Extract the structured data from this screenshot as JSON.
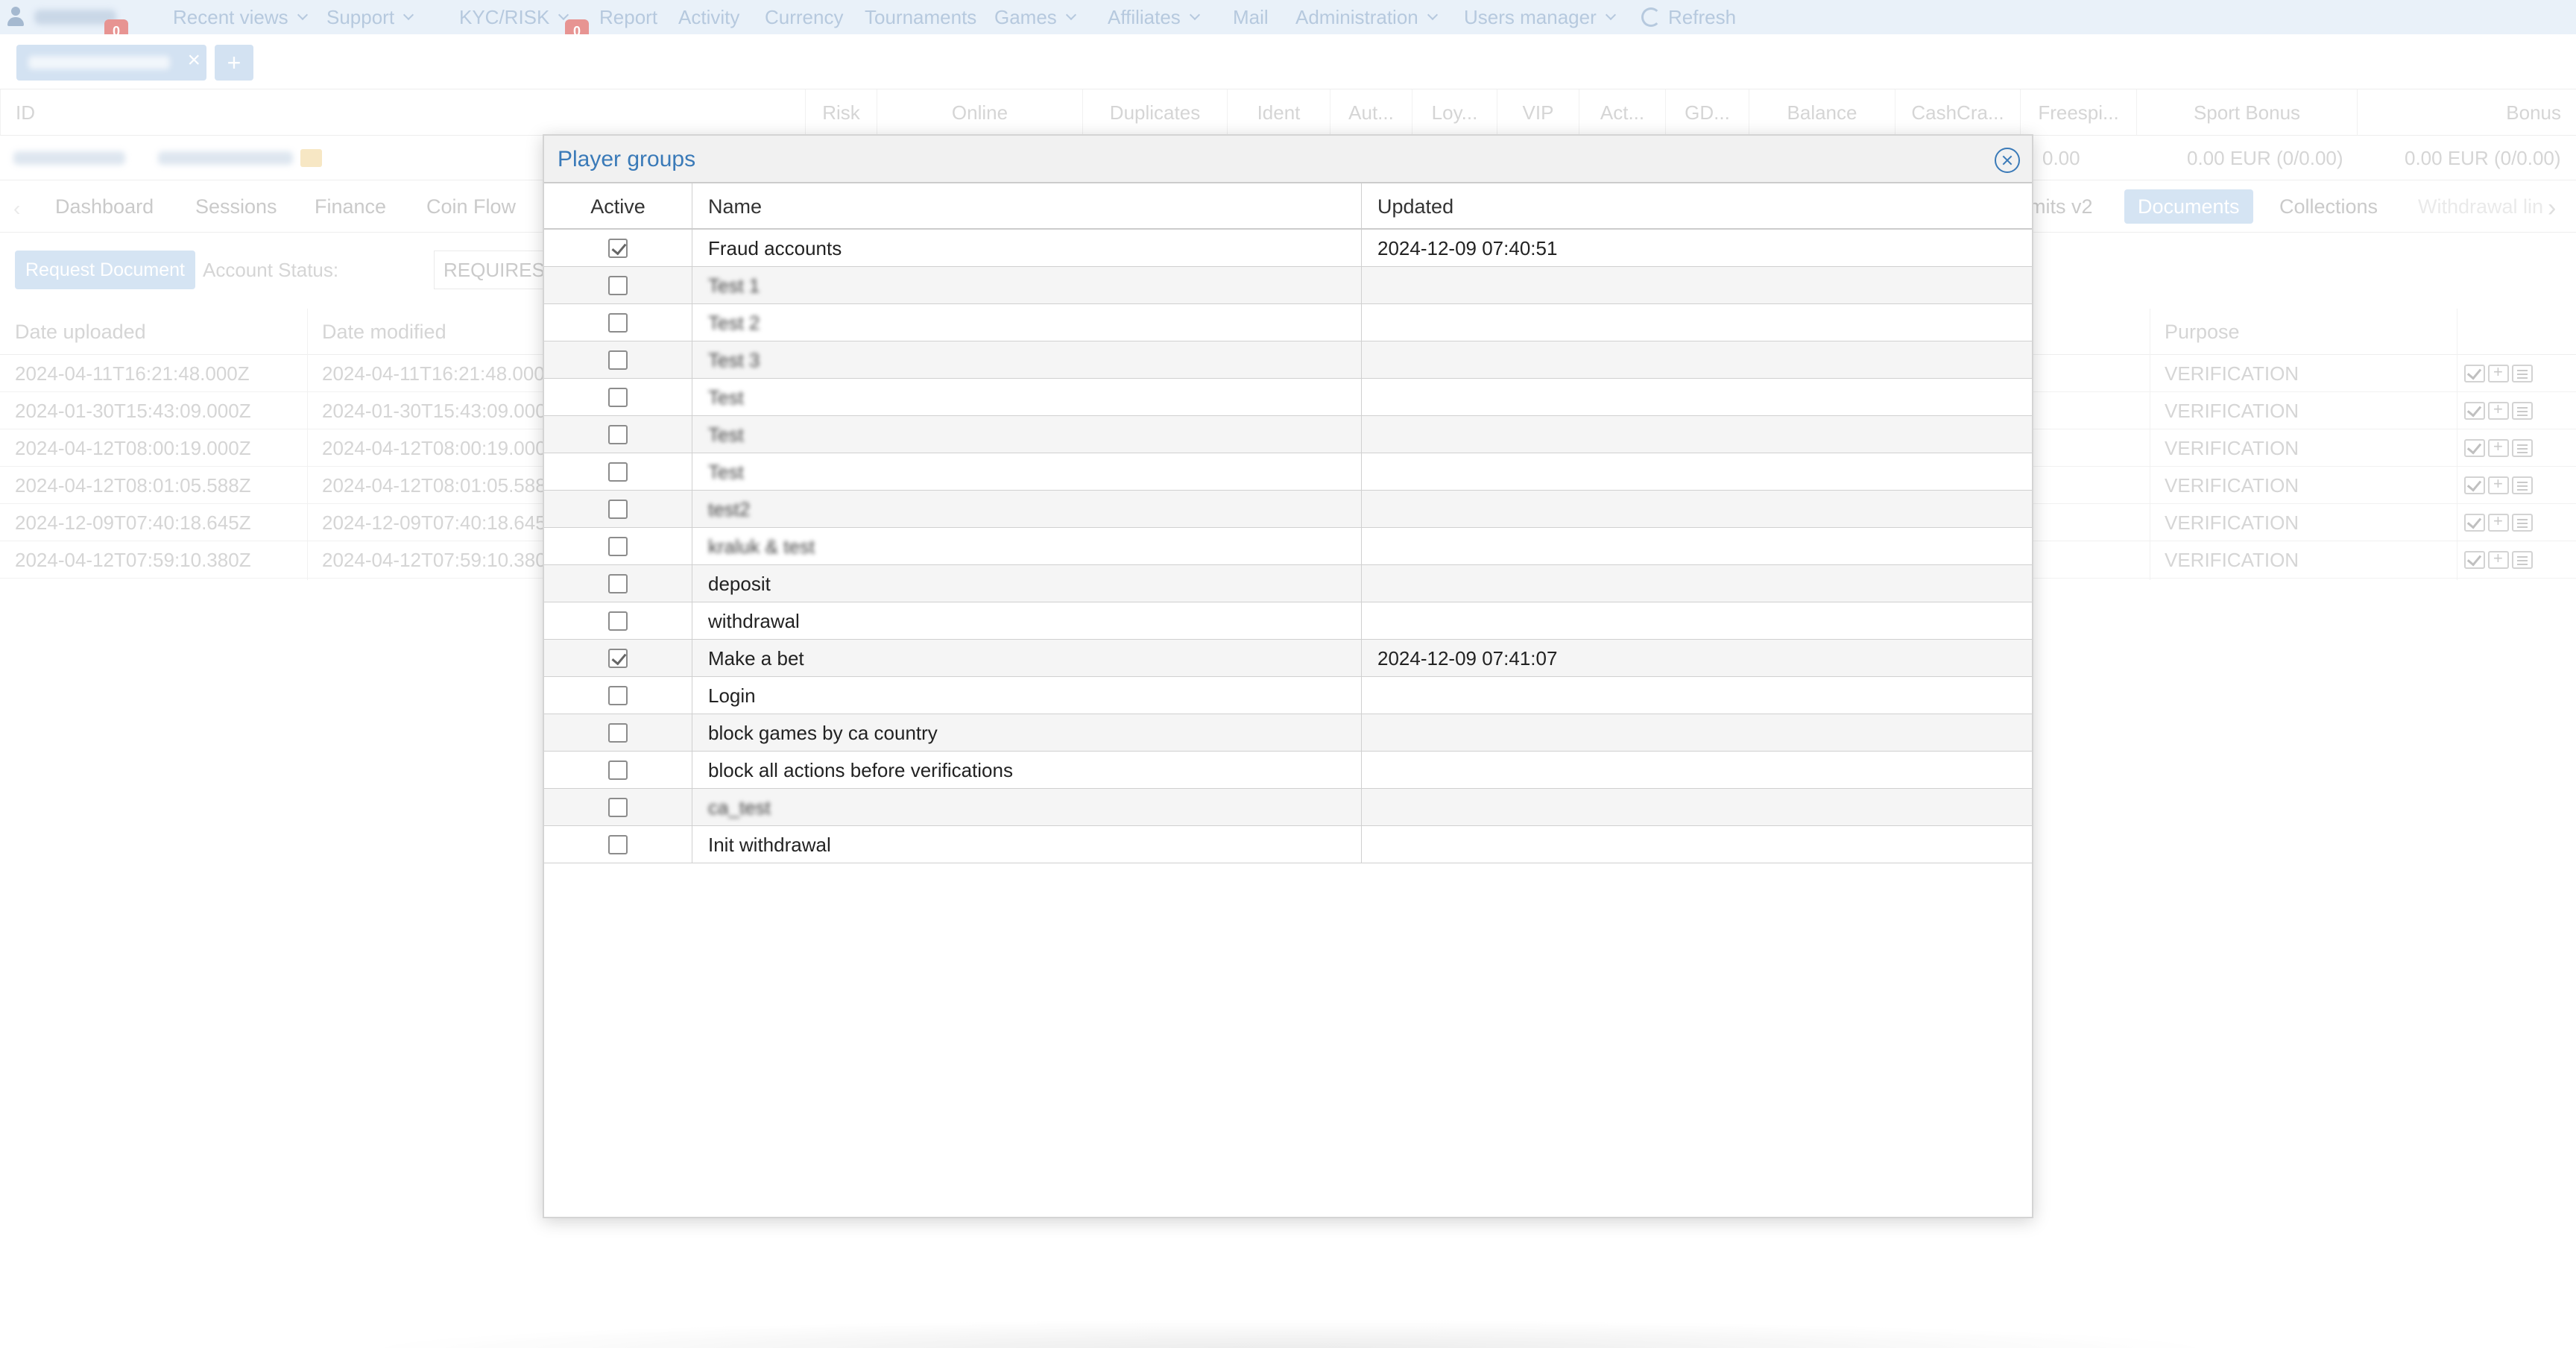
{
  "nav": {
    "user_badge": "0",
    "kyc_badge": "0",
    "items": [
      {
        "label": "Recent views",
        "chevron": true
      },
      {
        "label": "Support",
        "chevron": true
      },
      {
        "label": "KYC/RISK",
        "chevron": true
      },
      {
        "label": "Report",
        "chevron": false
      },
      {
        "label": "Activity",
        "chevron": false
      },
      {
        "label": "Currency",
        "chevron": false
      },
      {
        "label": "Tournaments",
        "chevron": false
      },
      {
        "label": "Games",
        "chevron": true
      },
      {
        "label": "Affiliates",
        "chevron": true
      },
      {
        "label": "Mail",
        "chevron": false
      },
      {
        "label": "Administration",
        "chevron": true
      },
      {
        "label": "Users manager",
        "chevron": true
      }
    ],
    "refresh_label": "Refresh"
  },
  "tabs": {
    "close_symbol": "×",
    "add_symbol": "+"
  },
  "player_header": {
    "columns": [
      "ID",
      "Risk",
      "Online",
      "Duplicates",
      "Ident",
      "Aut...",
      "Loy...",
      "VIP",
      "Act...",
      "GD...",
      "Balance",
      "CashCra...",
      "Freespi...",
      "Sport Bonus",
      "Bonus"
    ],
    "freespins_value": "0.00",
    "sport_bonus_value": "0.00 EUR (0/0.00)",
    "bonus_value": "0.00 EUR (0/0.00)"
  },
  "sections": {
    "tabs": [
      "Dashboard",
      "Sessions",
      "Finance",
      "Coin Flow",
      "mits v2",
      "Documents",
      "Collections",
      "Withdrawal lin"
    ],
    "active": "Documents"
  },
  "toolbar": {
    "request_label": "Request Document",
    "account_status_label": "Account Status:",
    "account_status_value": "REQUIRES"
  },
  "documents": {
    "headers": {
      "uploaded": "Date uploaded",
      "modified": "Date modified",
      "purpose": "Purpose"
    },
    "rows": [
      {
        "uploaded": "2024-04-11T16:21:48.000Z",
        "modified": "2024-04-11T16:21:48.000",
        "purpose": "VERIFICATION"
      },
      {
        "uploaded": "2024-01-30T15:43:09.000Z",
        "modified": "2024-01-30T15:43:09.000",
        "purpose": "VERIFICATION"
      },
      {
        "uploaded": "2024-04-12T08:00:19.000Z",
        "modified": "2024-04-12T08:00:19.000",
        "purpose": "VERIFICATION"
      },
      {
        "uploaded": "2024-04-12T08:01:05.588Z",
        "modified": "2024-04-12T08:01:05.588",
        "purpose": "VERIFICATION"
      },
      {
        "uploaded": "2024-12-09T07:40:18.645Z",
        "modified": "2024-12-09T07:40:18.645",
        "purpose": "VERIFICATION"
      },
      {
        "uploaded": "2024-04-12T07:59:10.380Z",
        "modified": "2024-04-12T07:59:10.380",
        "purpose": "VERIFICATION"
      }
    ]
  },
  "modal": {
    "title": "Player groups",
    "headers": {
      "active": "Active",
      "name": "Name",
      "updated": "Updated"
    },
    "rows": [
      {
        "checked": true,
        "name": "Fraud accounts",
        "updated": "2024-12-09 07:40:51",
        "blurred": false
      },
      {
        "checked": false,
        "name": "Test 1",
        "updated": "",
        "blurred": true
      },
      {
        "checked": false,
        "name": "Test 2",
        "updated": "",
        "blurred": true
      },
      {
        "checked": false,
        "name": "Test 3",
        "updated": "",
        "blurred": true
      },
      {
        "checked": false,
        "name": "Test",
        "updated": "",
        "blurred": true
      },
      {
        "checked": false,
        "name": "Test",
        "updated": "",
        "blurred": true
      },
      {
        "checked": false,
        "name": "Test",
        "updated": "",
        "blurred": true
      },
      {
        "checked": false,
        "name": "test2",
        "updated": "",
        "blurred": true
      },
      {
        "checked": false,
        "name": "kraluk & test",
        "updated": "",
        "blurred": true
      },
      {
        "checked": false,
        "name": "deposit",
        "updated": "",
        "blurred": false
      },
      {
        "checked": false,
        "name": "withdrawal",
        "updated": "",
        "blurred": false
      },
      {
        "checked": true,
        "name": "Make a bet",
        "updated": "2024-12-09 07:41:07",
        "blurred": false
      },
      {
        "checked": false,
        "name": "Login",
        "updated": "",
        "blurred": false
      },
      {
        "checked": false,
        "name": "block games by ca country",
        "updated": "",
        "blurred": false
      },
      {
        "checked": false,
        "name": "block all actions before verifications",
        "updated": "",
        "blurred": false
      },
      {
        "checked": false,
        "name": "ca_test",
        "updated": "",
        "blurred": true
      },
      {
        "checked": false,
        "name": "Init withdrawal",
        "updated": "",
        "blurred": false
      }
    ]
  }
}
